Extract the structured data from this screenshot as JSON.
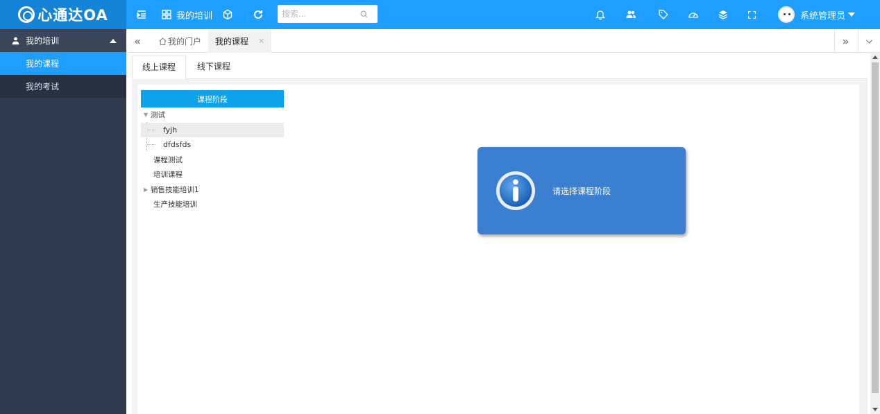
{
  "app": {
    "logo_text": "心通达OA"
  },
  "header": {
    "current_module": "我的培训",
    "search_placeholder": "搜索...",
    "user_name": "系统管理员"
  },
  "sidebar": {
    "group_title": "我的培训",
    "items": [
      {
        "label": "我的课程",
        "active": true
      },
      {
        "label": "我的考试",
        "active": false
      }
    ]
  },
  "tabs": [
    {
      "label": "我的门户",
      "icon": "home-icon"
    },
    {
      "label": "我的课程",
      "active": true
    }
  ],
  "subtabs": [
    {
      "label": "线上课程",
      "active": true
    },
    {
      "label": "线下课程"
    }
  ],
  "tree": {
    "header": "课程阶段",
    "nodes": [
      {
        "label": "测试",
        "expanded": true,
        "children": [
          "fyjh",
          "dfdsfds"
        ]
      },
      {
        "label": "课程测试"
      },
      {
        "label": "培训课程"
      },
      {
        "label": "销售技能培训1",
        "collapsed": true
      },
      {
        "label": "生产技能培训"
      }
    ]
  },
  "message": {
    "text": "请选择课程阶段"
  },
  "colors": {
    "primary": "#1E9FFF",
    "sidebar": "#2f3a4f",
    "msgbox": "#3a7fd0"
  }
}
